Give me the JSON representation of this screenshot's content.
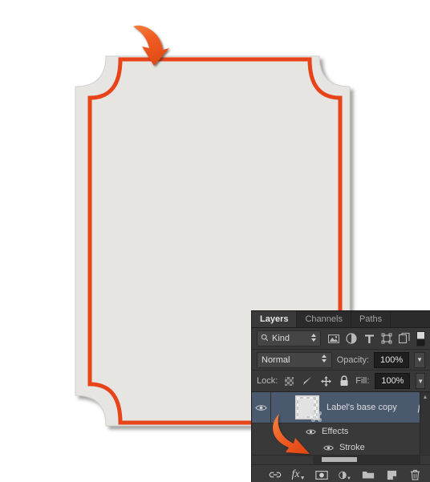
{
  "canvas": {
    "background_color": "#ffffff",
    "shape_fill": "#e6e5e2",
    "shape_stroke_color": "#e8441a",
    "shape_shadow_color": "#8e8e8e",
    "annotation_arrow_color": "#ef5a22"
  },
  "panel": {
    "tabs": [
      {
        "label": "Layers",
        "active": true
      },
      {
        "label": "Channels",
        "active": false
      },
      {
        "label": "Paths",
        "active": false
      }
    ],
    "filter": {
      "search_icon": "search-icon",
      "kind_label": "Kind",
      "stepper_icon": "updown-stepper-icon",
      "type_filters": [
        {
          "name": "pixel-layer-filter-icon"
        },
        {
          "name": "adjustment-layer-filter-icon"
        },
        {
          "name": "type-layer-filter-icon"
        },
        {
          "name": "shape-layer-filter-icon"
        },
        {
          "name": "smart-object-filter-icon"
        }
      ],
      "toggle_icon": "filter-enable-toggle-icon"
    },
    "blend": {
      "mode": "Normal",
      "opacity_label": "Opacity:",
      "opacity_value": "100%"
    },
    "lock": {
      "label": "Lock:",
      "items": [
        {
          "name": "lock-transparent-pixels-icon"
        },
        {
          "name": "lock-image-pixels-icon"
        },
        {
          "name": "lock-position-icon"
        },
        {
          "name": "lock-all-icon"
        }
      ],
      "fill_label": "Fill:",
      "fill_value": "100%"
    },
    "layers": [
      {
        "name": "Label's base copy",
        "visible": true,
        "selected": true,
        "has_fx": true,
        "fx_badge": "fx",
        "effects": [
          {
            "label": "Effects",
            "visible": true,
            "indent": 1
          },
          {
            "label": "Stroke",
            "visible": true,
            "indent": 2
          }
        ]
      }
    ],
    "footer_buttons": [
      {
        "name": "link-layers-button",
        "glyph": "link-icon"
      },
      {
        "name": "add-layer-style-button",
        "glyph": "fx-icon"
      },
      {
        "name": "add-layer-mask-button",
        "glyph": "mask-icon"
      },
      {
        "name": "new-fill-adjustment-button",
        "glyph": "half-circle-icon"
      },
      {
        "name": "new-group-button",
        "glyph": "folder-icon"
      },
      {
        "name": "new-layer-button",
        "glyph": "new-layer-icon"
      },
      {
        "name": "delete-layer-button",
        "glyph": "trash-icon"
      }
    ],
    "scrollbar": {
      "vertical_up_glyph": "▲"
    }
  }
}
